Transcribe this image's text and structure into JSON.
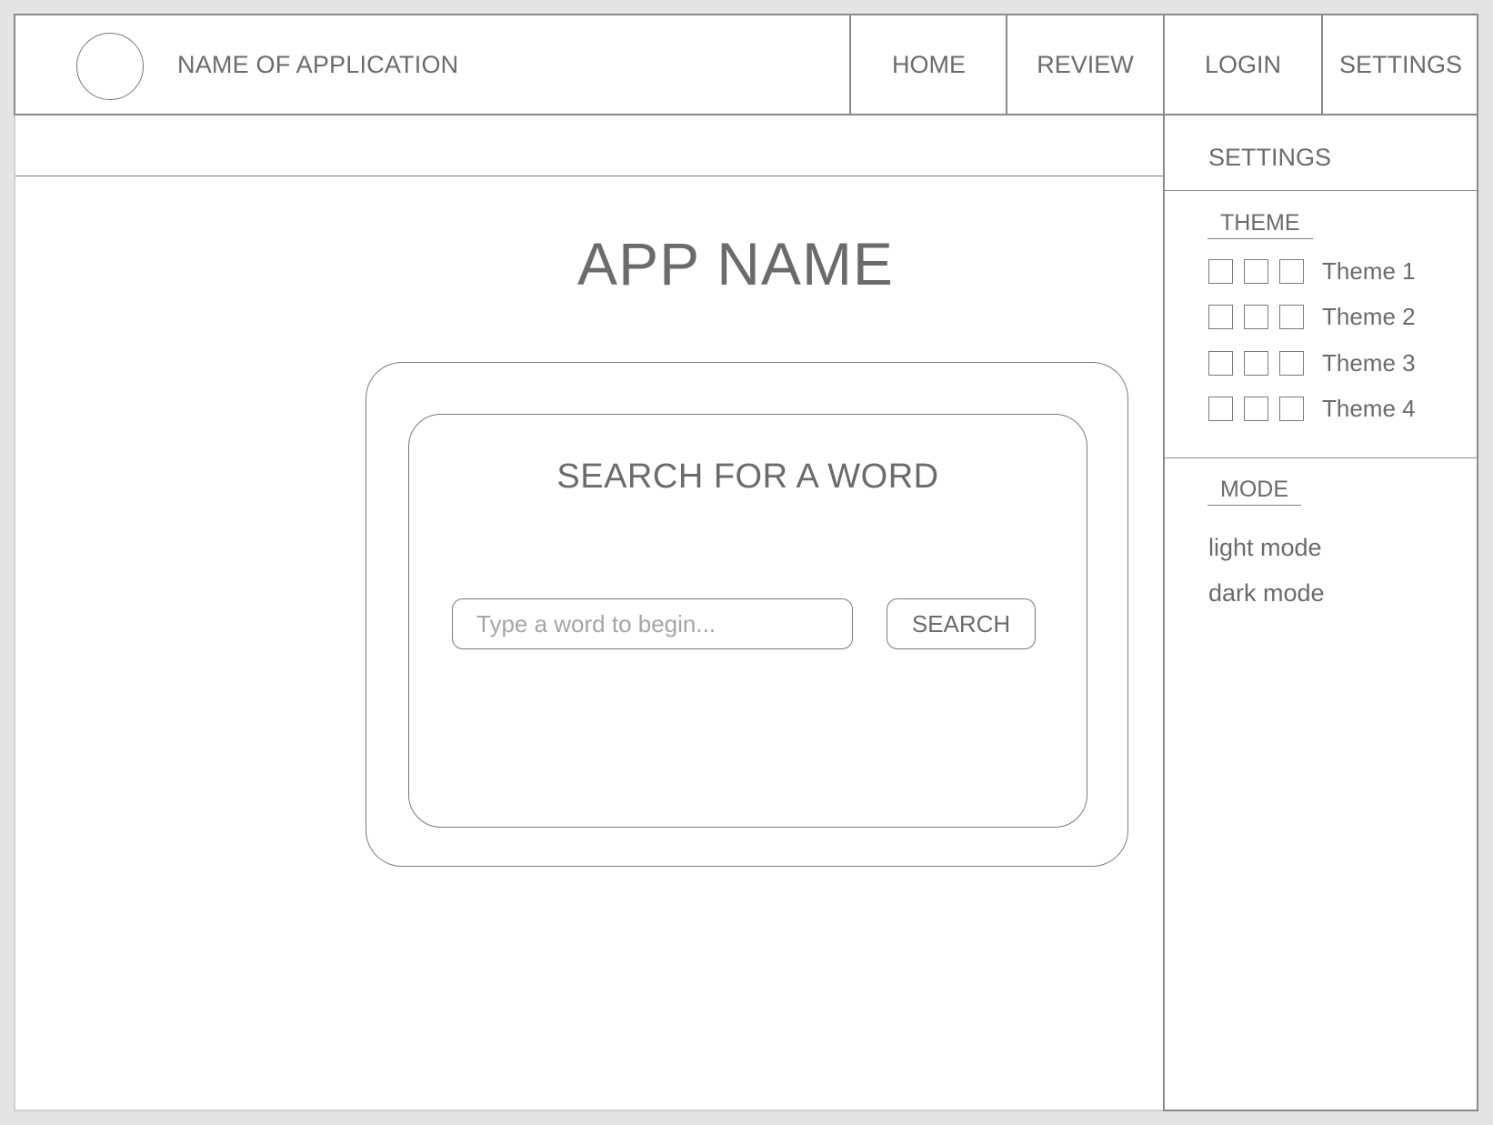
{
  "header": {
    "app_name": "NAME OF APPLICATION",
    "nav": {
      "home": "HOME",
      "review": "REVIEW",
      "login": "LOGIN",
      "settings": "SETTINGS"
    }
  },
  "main": {
    "title": "APP NAME",
    "search": {
      "heading": "SEARCH FOR A WORD",
      "placeholder": "Type a word to begin...",
      "value": "",
      "button_label": "SEARCH"
    }
  },
  "settings_panel": {
    "title": "SETTINGS",
    "theme_section_label": "THEME",
    "themes": [
      {
        "label": "Theme 1"
      },
      {
        "label": "Theme 2"
      },
      {
        "label": "Theme 3"
      },
      {
        "label": "Theme 4"
      }
    ],
    "mode_section_label": "MODE",
    "modes": [
      {
        "label": "light mode"
      },
      {
        "label": "dark mode"
      }
    ]
  },
  "colors": {
    "background": "#e4e4e4",
    "surface": "#ffffff",
    "border": "#8a8a8a",
    "text": "#6b6b6b",
    "placeholder": "#a5a5a5"
  }
}
